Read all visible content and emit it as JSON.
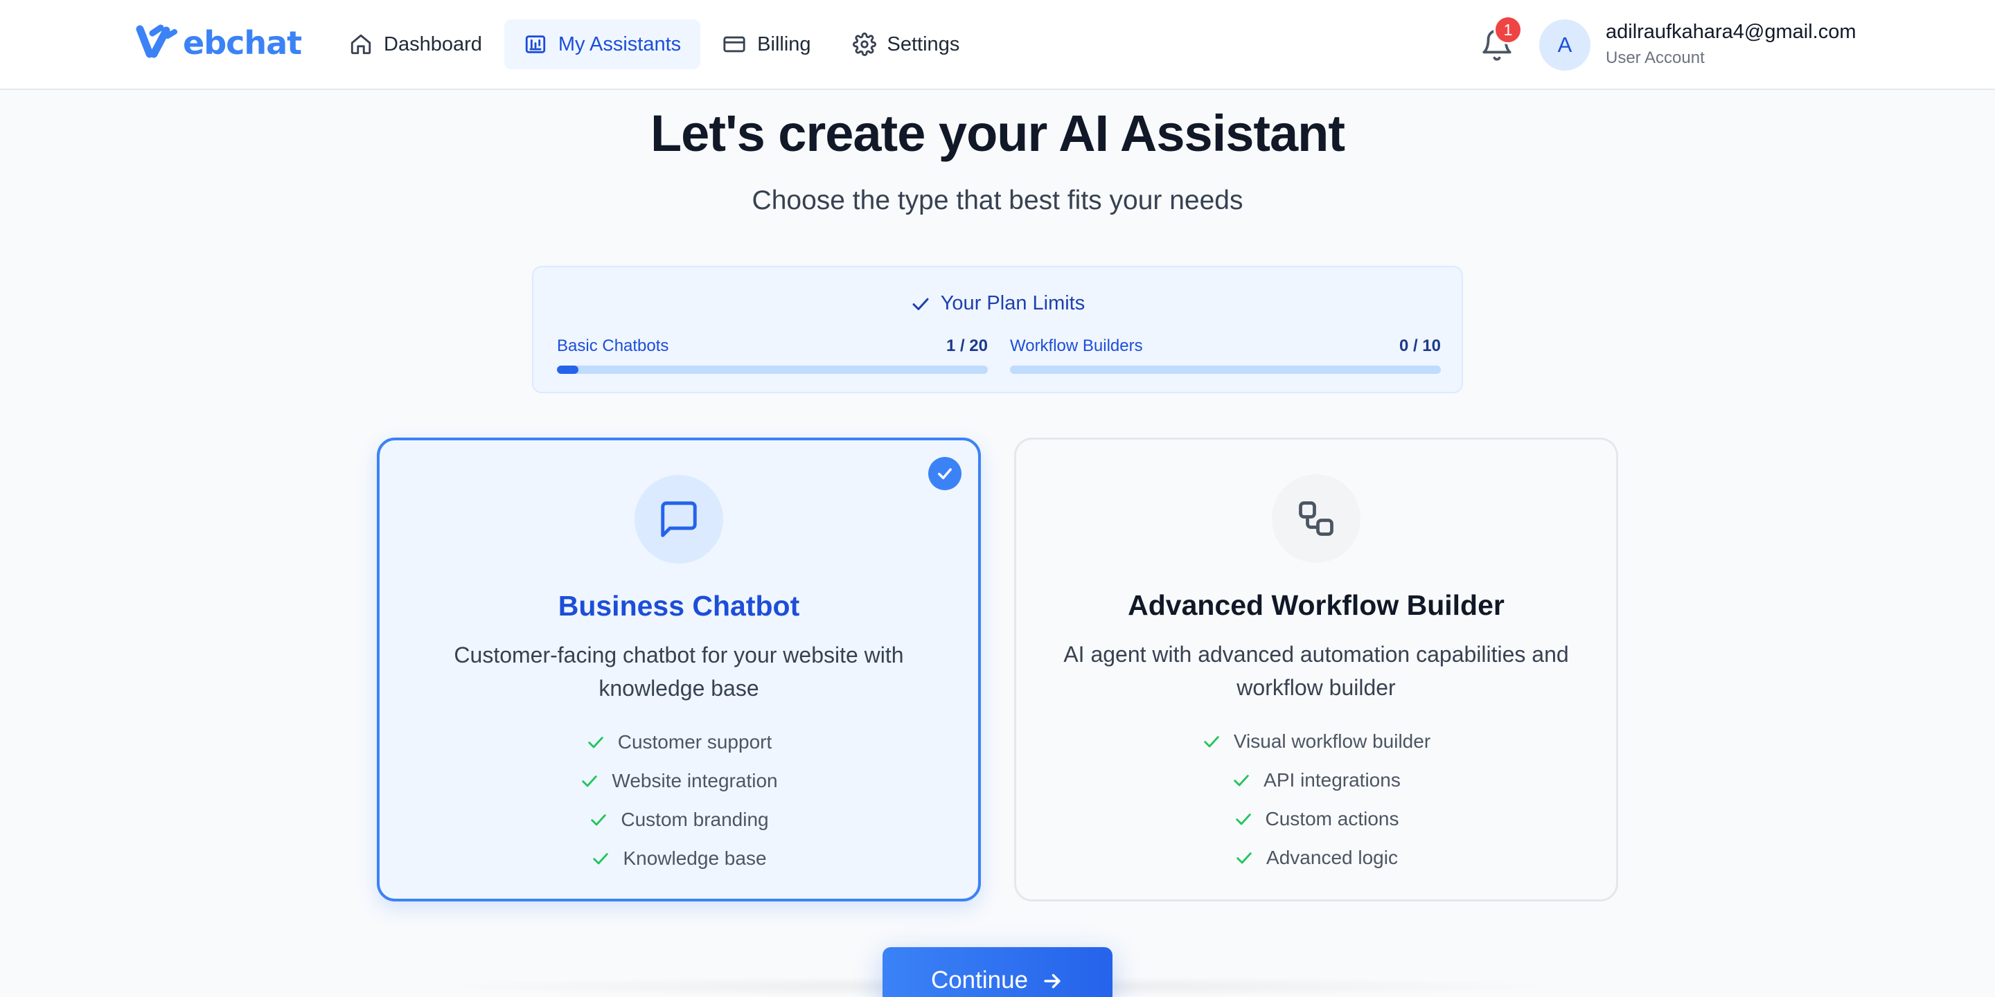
{
  "colors": {
    "brand": "#3b82f6",
    "brand_dark": "#1d4ed8",
    "success": "#22c55e",
    "badge": "#ef4444",
    "background": "#f8fafc"
  },
  "header": {
    "logo_text": "ebchat",
    "nav": [
      {
        "label": "Dashboard",
        "icon": "home-icon"
      },
      {
        "label": "My Assistants",
        "icon": "assistant-icon",
        "active": true
      },
      {
        "label": "Billing",
        "icon": "credit-card-icon"
      },
      {
        "label": "Settings",
        "icon": "gear-icon"
      }
    ],
    "notifications": {
      "count": "1",
      "icon": "bell-icon"
    },
    "user": {
      "initial": "A",
      "email": "adilraufkahara4@gmail.com",
      "role": "User Account"
    }
  },
  "main": {
    "title": "Let's create your AI Assistant",
    "subtitle": "Choose the type that best fits your needs"
  },
  "plan_limits": {
    "title": "Your Plan Limits",
    "items": [
      {
        "label": "Basic Chatbots",
        "count": "1 / 20",
        "used": 1,
        "max": 20
      },
      {
        "label": "Workflow Builders",
        "count": "0 / 10",
        "used": 0,
        "max": 10
      }
    ]
  },
  "cards": [
    {
      "title": "Business Chatbot",
      "description": "Customer-facing chatbot for your website with knowledge base",
      "icon": "chat-bubble-icon",
      "selected": true,
      "features": [
        "Customer support",
        "Website integration",
        "Custom branding",
        "Knowledge base"
      ]
    },
    {
      "title": "Advanced Workflow Builder",
      "description": "AI agent with advanced automation capabilities and workflow builder",
      "icon": "workflow-icon",
      "selected": false,
      "features": [
        "Visual workflow builder",
        "API integrations",
        "Custom actions",
        "Advanced logic"
      ]
    }
  ],
  "continue_label": "Continue"
}
